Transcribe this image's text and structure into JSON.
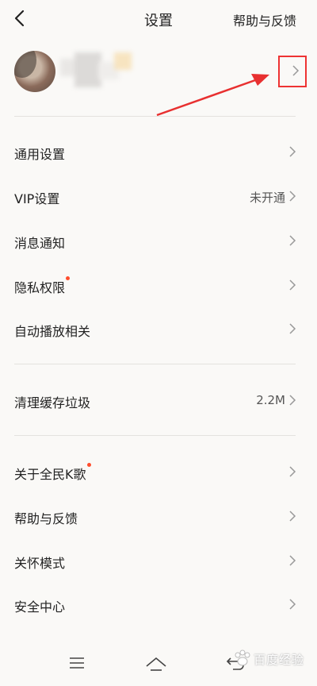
{
  "header": {
    "title": "设置",
    "help_label": "帮助与反馈",
    "back_icon": "back-arrow-icon"
  },
  "profile": {
    "avatar_icon": "avatar",
    "chevron_icon": "chevron-right-icon",
    "annotation_color": "#e33333"
  },
  "sections": {
    "group1": [
      {
        "label": "通用设置",
        "value": "",
        "badge": false
      },
      {
        "label": "VIP设置",
        "value": "未开通",
        "badge": false
      },
      {
        "label": "消息通知",
        "value": "",
        "badge": false
      },
      {
        "label": "隐私权限",
        "value": "",
        "badge": true
      },
      {
        "label": "自动播放相关",
        "value": "",
        "badge": false
      }
    ],
    "group2": [
      {
        "label": "清理缓存垃圾",
        "value": "2.2M",
        "badge": false
      }
    ],
    "group3": [
      {
        "label": "关于全民K歌",
        "value": "",
        "badge": true
      },
      {
        "label": "帮助与反馈",
        "value": "",
        "badge": false
      },
      {
        "label": "关怀模式",
        "value": "",
        "badge": false
      },
      {
        "label": "安全中心",
        "value": "",
        "badge": false
      }
    ]
  },
  "bottom_nav": {
    "menu_icon": "menu-icon",
    "home_icon": "home-icon",
    "back_icon": "system-back-icon"
  },
  "watermark": {
    "text": "百度经验"
  },
  "colors": {
    "badge": "#ff4d2d",
    "background": "#faf9f7",
    "divider": "#e4e2df"
  }
}
